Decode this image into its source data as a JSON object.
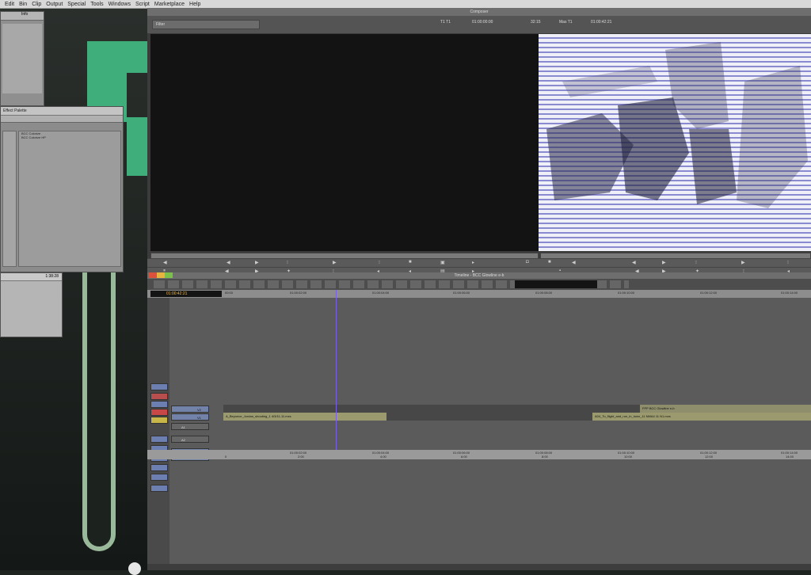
{
  "menubar": {
    "items": [
      "Edit",
      "Bin",
      "Clip",
      "Output",
      "Special",
      "Tools",
      "Windows",
      "Script",
      "Marketplace",
      "Help"
    ]
  },
  "bin_window": {
    "header": "Info"
  },
  "effect_palette": {
    "title": "Effect Palette",
    "items": [
      "BCC Colorize",
      "BCC Colorize HP"
    ]
  },
  "mini_window": {
    "duration": "1:38:28"
  },
  "composer": {
    "title": "Composer",
    "filter_tab": "Filter",
    "src_track": "T1 T1",
    "src_tc": "01:00:00:00",
    "rec_dur": "32:15",
    "rec_track": "Mas T1",
    "rec_tc": "01:00:42:21"
  },
  "timeline": {
    "title": "Timeline - BCC Glowline e-b",
    "timecode": "01:00:42:21",
    "ruler_labels": [
      "00:00",
      "01:00:02:00",
      "01:00:04:00",
      "01:00:06:00",
      "01:00:08:00",
      "01:00:10:00",
      "01:00:12:00",
      "01:00:14:00"
    ],
    "tracks": {
      "v2": "V2",
      "v1": "V1",
      "a1": "A1",
      "a2": "A2",
      "tc1": "TC1",
      "ec1": "EC1"
    },
    "clips": {
      "v2_effect": "FPP BCC Glowline e-b",
      "v1_clip_a": "A_Beyonce_Jordan_shooting_1 4/3/11-11.mxs",
      "v1_clip_b": "A04_To_flight_and_run_in_town_11 NMA4 11 N1.mxs"
    },
    "bottom_tc": [
      "01:00:02:00",
      "01:00:04:00",
      "01:00:06:00",
      "01:00:08:00",
      "01:00:10:00",
      "01:00:12:00",
      "01:00:14:00"
    ],
    "bottom_frames": [
      "0",
      "2:00",
      "4:00",
      "6:00",
      "8:00",
      "10:00",
      "12:00",
      "14:00"
    ]
  },
  "colors": {
    "clip_green": "#9a9a6e",
    "effect_clip": "#8e8e6c",
    "playhead": "#7b5fe0",
    "timecode": "#f2c04a"
  }
}
